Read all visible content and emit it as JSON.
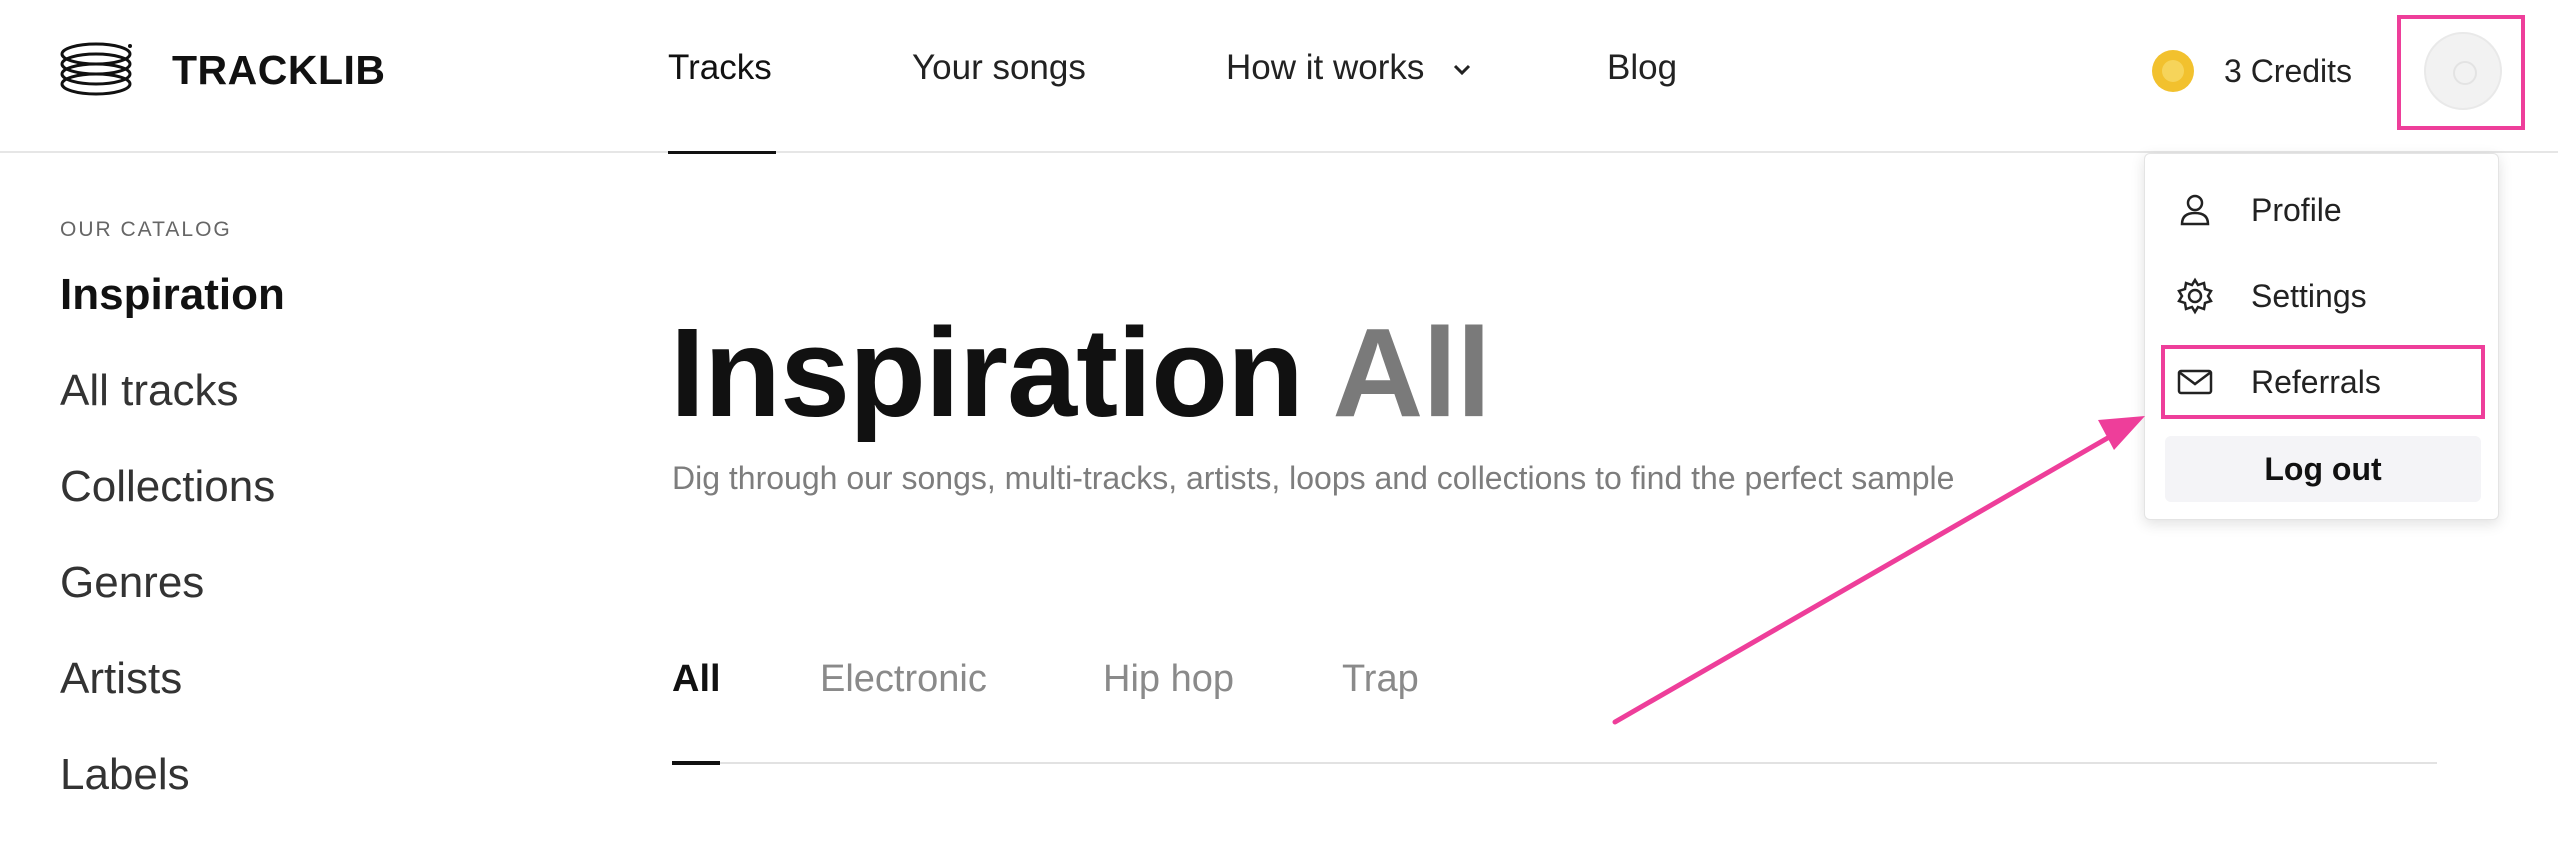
{
  "brand": {
    "name": "TRACKLIB",
    "logo_icon": "stacked-rings-icon"
  },
  "nav": {
    "items": [
      {
        "label": "Tracks",
        "active": true
      },
      {
        "label": "Your songs"
      },
      {
        "label": "How it works"
      },
      {
        "label": "Blog"
      }
    ]
  },
  "credits": {
    "label": "3 Credits",
    "icon": "coin-icon"
  },
  "sidebar": {
    "section_label": "OUR CATALOG",
    "items": [
      {
        "label": "Inspiration",
        "active": true
      },
      {
        "label": "All tracks"
      },
      {
        "label": "Collections"
      },
      {
        "label": "Genres"
      },
      {
        "label": "Artists"
      },
      {
        "label": "Labels"
      }
    ]
  },
  "main": {
    "title": "Inspiration",
    "title_muted": "All",
    "subtitle": "Dig through our songs, multi-tracks, artists, loops and collections to find the perfect sample",
    "filters": [
      {
        "label": "All",
        "active": true
      },
      {
        "label": "Electronic"
      },
      {
        "label": "Hip hop"
      },
      {
        "label": "Trap"
      }
    ]
  },
  "dropdown": {
    "items": [
      {
        "label": "Profile",
        "icon": "user-icon"
      },
      {
        "label": "Settings",
        "icon": "gear-icon"
      },
      {
        "label": "Referrals",
        "icon": "mail-icon",
        "highlighted": true
      }
    ],
    "logout_label": "Log out"
  },
  "colors": {
    "highlight": "#ee3e9a",
    "coin": "#f2c12e",
    "muted_text": "#7a7a7a"
  }
}
